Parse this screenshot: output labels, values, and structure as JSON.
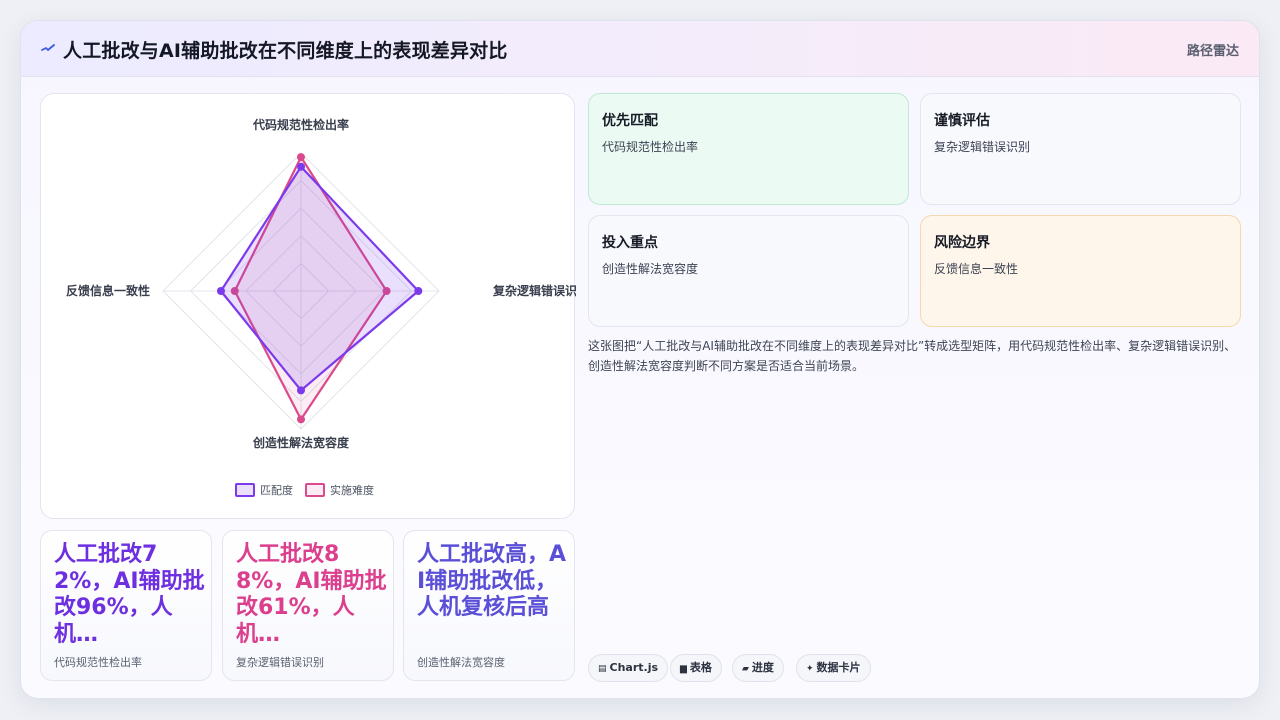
{
  "header": {
    "title": "人工批改与AI辅助批改在不同维度上的表现差异对比",
    "badge": "路径雷达"
  },
  "chart_data": {
    "type": "radar",
    "axes": [
      "代码规范性检出率",
      "复杂逻辑错误识别",
      "创造性解法宽容度",
      "反馈信息一致性"
    ],
    "scale_max": 100,
    "series": [
      {
        "name": "匹配度",
        "values": [
          90,
          85,
          72,
          58
        ],
        "color": "#7c3aed",
        "fill": "rgba(124,58,237,0.16)"
      },
      {
        "name": "实施难度",
        "values": [
          97,
          62,
          93,
          48
        ],
        "color": "#db4a8c",
        "fill": "rgba(219,74,140,0.10)"
      }
    ],
    "legend_position": "bottom"
  },
  "stats": [
    {
      "value": "人工批改72%，AI辅助批改96%，人机…",
      "label": "代码规范性检出率",
      "color": "#6d2fe0"
    },
    {
      "value": "人工批改88%，AI辅助批改61%，人机…",
      "label": "复杂逻辑错误识别",
      "color": "#db3f8e"
    },
    {
      "value": "人工批改高，AI辅助批改低，人机复核后高",
      "label": "创造性解法宽容度",
      "color": "#5b4fd8"
    }
  ],
  "recommendations": [
    {
      "heading": "优先匹配",
      "body": "代码规范性检出率",
      "tone": "green"
    },
    {
      "heading": "谨慎评估",
      "body": "复杂逻辑错误识别",
      "tone": "neutral"
    },
    {
      "heading": "投入重点",
      "body": "创造性解法宽容度",
      "tone": "neutral"
    },
    {
      "heading": "风险边界",
      "body": "反馈信息一致性",
      "tone": "orange"
    }
  ],
  "description": "这张图把“人工批改与AI辅助批改在不同维度上的表现差异对比”转成选型矩阵，用代码规范性检出率、复杂逻辑错误识别、创造性解法宽容度判断不同方案是否适合当前场景。",
  "chips": [
    {
      "icon": "chart-icon",
      "label": "Chart.js"
    },
    {
      "icon": "table-icon",
      "label": "表格"
    },
    {
      "icon": "progress-icon",
      "label": "进度"
    },
    {
      "icon": "sparkle-icon",
      "label": "数据卡片"
    }
  ]
}
